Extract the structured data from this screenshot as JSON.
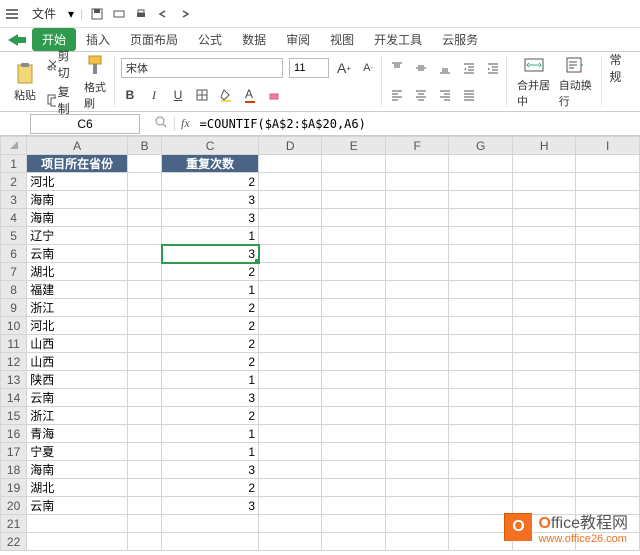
{
  "menubar": {
    "file_label": "文件"
  },
  "tabs": {
    "start": "开始",
    "insert": "插入",
    "layout": "页面布局",
    "formula": "公式",
    "data": "数据",
    "review": "审阅",
    "view": "视图",
    "developer": "开发工具",
    "cloud": "云服务"
  },
  "ribbon": {
    "paste": "粘贴",
    "cut": "剪切",
    "copy": "复制",
    "format_painter": "格式刷",
    "font_name": "宋体",
    "font_size": "11",
    "merge_center": "合并居中",
    "wrap_text": "自动换行",
    "general": "常规"
  },
  "namebox": "C6",
  "formula": "=COUNTIF($A$2:$A$20,A6)",
  "columns": [
    "A",
    "B",
    "C",
    "D",
    "E",
    "F",
    "G",
    "H",
    "I"
  ],
  "headerA": "项目所在省份",
  "headerC": "重复次数",
  "rows": [
    {
      "r": 2,
      "a": "河北",
      "c": 2
    },
    {
      "r": 3,
      "a": "海南",
      "c": 3
    },
    {
      "r": 4,
      "a": "海南",
      "c": 3
    },
    {
      "r": 5,
      "a": "辽宁",
      "c": 1
    },
    {
      "r": 6,
      "a": "云南",
      "c": 3
    },
    {
      "r": 7,
      "a": "湖北",
      "c": 2
    },
    {
      "r": 8,
      "a": "福建",
      "c": 1
    },
    {
      "r": 9,
      "a": "浙江",
      "c": 2
    },
    {
      "r": 10,
      "a": "河北",
      "c": 2
    },
    {
      "r": 11,
      "a": "山西",
      "c": 2
    },
    {
      "r": 12,
      "a": "山西",
      "c": 2
    },
    {
      "r": 13,
      "a": "陕西",
      "c": 1
    },
    {
      "r": 14,
      "a": "云南",
      "c": 3
    },
    {
      "r": 15,
      "a": "浙江",
      "c": 2
    },
    {
      "r": 16,
      "a": "青海",
      "c": 1
    },
    {
      "r": 17,
      "a": "宁夏",
      "c": 1
    },
    {
      "r": 18,
      "a": "海南",
      "c": 3
    },
    {
      "r": 19,
      "a": "湖北",
      "c": 2
    },
    {
      "r": 20,
      "a": "云南",
      "c": 3
    }
  ],
  "selected_row": 6,
  "selected_col": "C",
  "watermark": {
    "title_prefix": "O",
    "title_rest": "ffice教程网",
    "url": "www.office26.com"
  }
}
